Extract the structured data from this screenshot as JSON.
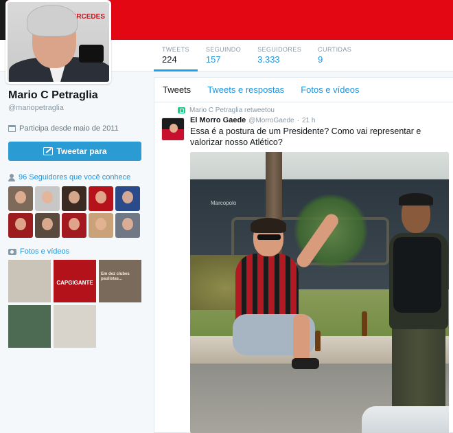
{
  "profile": {
    "avatar_sponsor_text": "MERCEDES",
    "name": "Mario C Petraglia",
    "handle": "@mariopetraglia",
    "joined": "Participa desde maio de 2011",
    "tweet_button": "Tweetar para",
    "followers_you_know": "96 Seguidores que você conhece",
    "media_heading": "Fotos e vídeos"
  },
  "stats": [
    {
      "label": "TWEETS",
      "value": "224"
    },
    {
      "label": "SEGUINDO",
      "value": "157"
    },
    {
      "label": "SEGUIDORES",
      "value": "3.333"
    },
    {
      "label": "CURTIDAS",
      "value": "9"
    }
  ],
  "timeline": {
    "tabs": [
      "Tweets",
      "Tweets e respostas",
      "Fotos e vídeos"
    ],
    "retweet_context": "Mario C Petraglia retweetou",
    "tweet": {
      "author": "El Morro Gaede",
      "author_handle": "@MorroGaede",
      "time": "21 h",
      "text": "Essa é a postura de um Presidente? Como vai representar e valorizar nosso Atlético?",
      "photo_sign": "Marcopolo"
    }
  },
  "media_thumbs": [
    {
      "caption": "",
      "bg": "#c9c3b8"
    },
    {
      "caption": "CAPGIGANTE",
      "bg": "#b3121b"
    },
    {
      "caption": "Em dez clubes paulistas...",
      "bg": "#7a6a5c"
    },
    {
      "caption": "",
      "bg": "#4d6b52"
    },
    {
      "caption": "",
      "bg": "#d8d4cc"
    }
  ],
  "colors": {
    "banner": "#e30613",
    "link": "#1b95e0",
    "button": "#2b9bd3"
  }
}
